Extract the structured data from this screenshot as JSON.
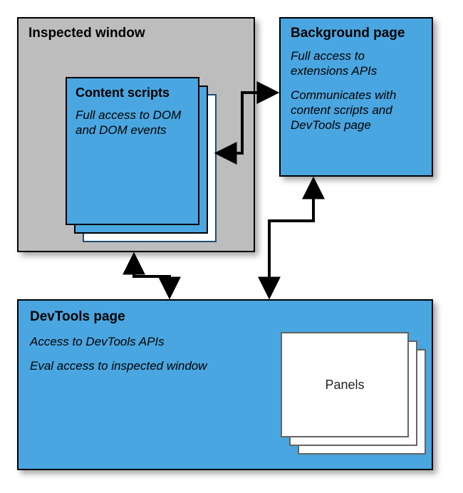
{
  "inspected_window": {
    "title": "Inspected window"
  },
  "content_scripts": {
    "title": "Content scripts",
    "description": "Full access to DOM and DOM events"
  },
  "background_page": {
    "title": "Background page",
    "desc1": "Full access to extensions APIs",
    "desc2": "Communicates with content scripts and DevTools page"
  },
  "devtools_page": {
    "title": "DevTools page",
    "desc1": "Access to DevTools APIs",
    "desc2": "Eval access to inspected window"
  },
  "panels": {
    "label": "Panels"
  },
  "connections": [
    {
      "from": "content_scripts",
      "to": "background_page",
      "bidirectional": true
    },
    {
      "from": "inspected_window",
      "to": "devtools_page",
      "bidirectional": true
    },
    {
      "from": "background_page",
      "to": "devtools_page",
      "bidirectional": true
    }
  ],
  "colors": {
    "blue": "#4aa6e0",
    "grey": "#bdbdbd",
    "white": "#ffffff",
    "black": "#000000"
  }
}
